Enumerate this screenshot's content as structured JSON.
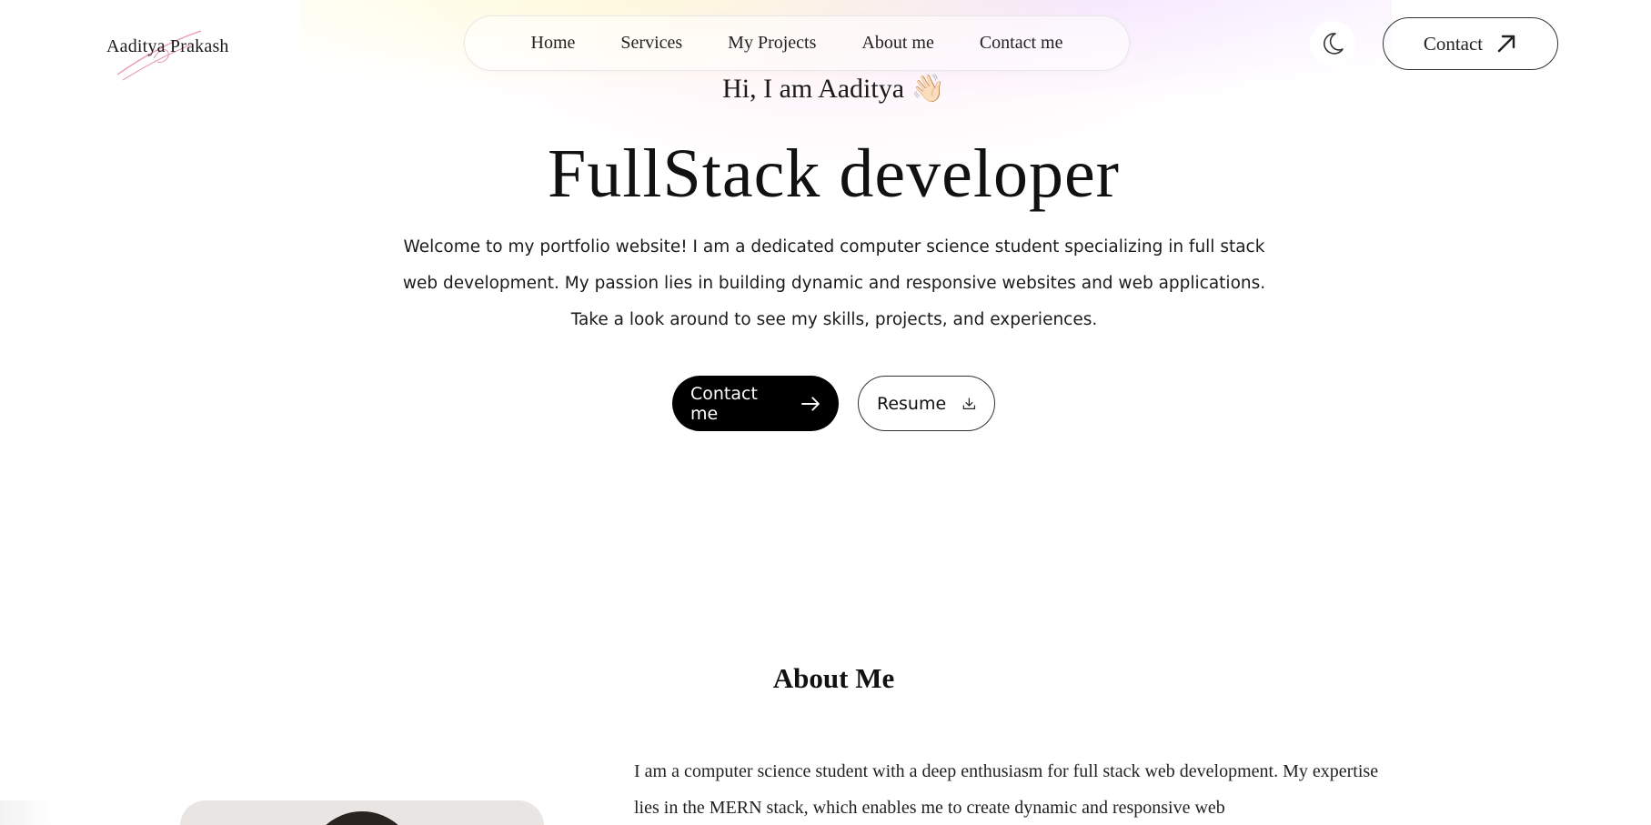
{
  "header": {
    "logo_text": "Aaditya Prakash",
    "nav": [
      {
        "label": "Home"
      },
      {
        "label": "Services"
      },
      {
        "label": "My Projects"
      },
      {
        "label": "About me"
      },
      {
        "label": "Contact me"
      }
    ],
    "theme_icon": "moon-icon",
    "contact_button": {
      "label": "Contact",
      "icon": "arrow-up-right-icon"
    }
  },
  "hero": {
    "greeting": "Hi, I am Aaditya 👋🏻",
    "title": "FullStack developer",
    "description": "Welcome to my portfolio website! I am a dedicated computer science student specializing in full stack web development. My passion lies in building dynamic and responsive websites and web applications. Take a look around to see my skills, projects, and experiences.",
    "primary_button": {
      "label": "Contact me",
      "icon": "arrow-right-icon"
    },
    "secondary_button": {
      "label": "Resume",
      "icon": "download-icon"
    }
  },
  "about": {
    "title": "About Me",
    "text": "I am a computer science student with a deep enthusiasm for full stack web development. My expertise lies in the MERN stack, which enables me to create dynamic and responsive web"
  },
  "colors": {
    "primary_button_bg": "#000000",
    "text": "#111111",
    "logo_swash": "#e79aae"
  }
}
